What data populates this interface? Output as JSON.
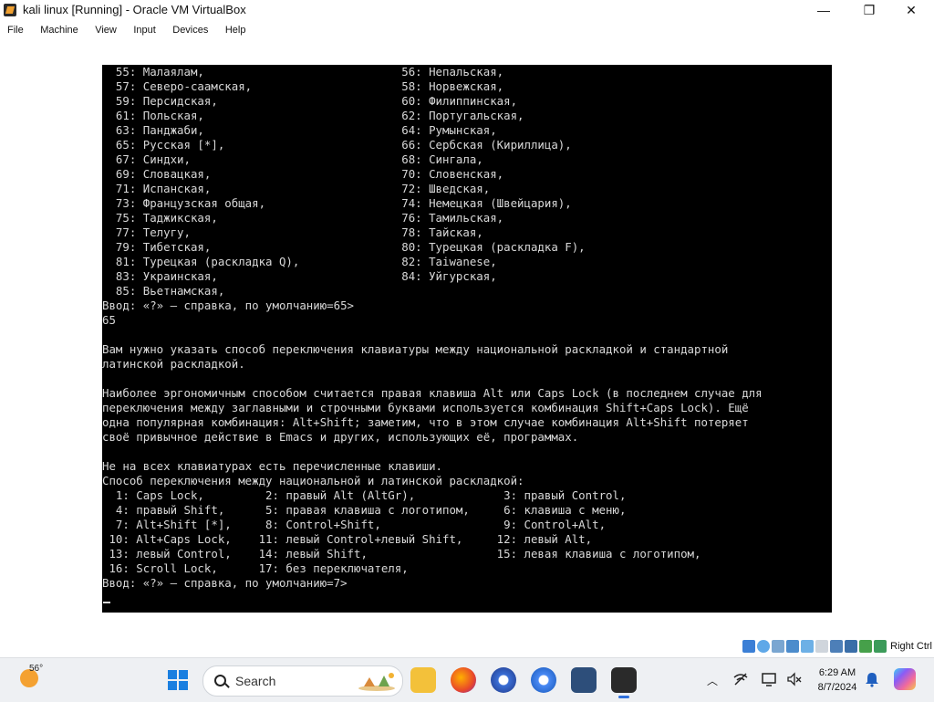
{
  "window": {
    "title": "kali linux [Running] - Oracle VM VirtualBox",
    "minimize": "—",
    "maximize": "❐",
    "close": "✕"
  },
  "menu": {
    "file": "File",
    "machine": "Machine",
    "view": "View",
    "input": "Input",
    "devices": "Devices",
    "help": "Help"
  },
  "console": {
    "lines": [
      "  55: Малаялам,                             56: Непальская,",
      "  57: Северо-саамская,                      58: Норвежская,",
      "  59: Персидская,                           60: Филиппинская,",
      "  61: Польская,                             62: Португальская,",
      "  63: Панджаби,                             64: Румынская,",
      "  65: Русская [*],                          66: Сербская (Кириллица),",
      "  67: Синдхи,                               68: Сингала,",
      "  69: Словацкая,                            70: Словенская,",
      "  71: Испанская,                            72: Шведская,",
      "  73: Французская общая,                    74: Немецкая (Швейцария),",
      "  75: Таджикская,                           76: Тамильская,",
      "  77: Телугу,                               78: Тайская,",
      "  79: Тибетская,                            80: Турецкая (раскладка F),",
      "  81: Турецкая (раскладка Q),               82: Taiwanese,",
      "  83: Украинская,                           84: Уйгурская,",
      "  85: Вьетнамская,",
      "Ввод: «?» — справка, по умолчанию=65>",
      "65",
      "",
      "Вам нужно указать способ переключения клавиатуры между национальной раскладкой и стандартной",
      "латинской раскладкой.",
      "",
      "Наиболее эргономичным способом считается правая клавиша Alt или Caps Lock (в последнем случае для",
      "переключения между заглавными и строчными буквами используется комбинация Shift+Caps Lock). Ещё",
      "одна популярная комбинация: Alt+Shift; заметим, что в этом случае комбинация Alt+Shift потеряет",
      "своё привычное действие в Emacs и других, использующих её, программах.",
      "",
      "Не на всех клавиатурах есть перечисленные клавиши.",
      "Способ переключения между национальной и латинской раскладкой:",
      "  1: Caps Lock,         2: правый Alt (AltGr),             3: правый Control,",
      "  4: правый Shift,      5: правая клавиша с логотипом,     6: клавиша с меню,",
      "  7: Alt+Shift [*],     8: Control+Shift,                  9: Control+Alt,",
      " 10: Alt+Caps Lock,    11: левый Control+левый Shift,     12: левый Alt,",
      " 13: левый Control,    14: левый Shift,                   15: левая клавиша с логотипом,",
      " 16: Scroll Lock,      17: без переключателя,",
      "Ввод: «?» — справка, по умолчанию=7>"
    ]
  },
  "statusbar": {
    "host_key": "Right Ctrl",
    "icon_names": [
      "hard-disk-icon",
      "optical-drive-icon",
      "audio-icon",
      "network-icon",
      "usb-icon",
      "shared-folders-icon",
      "display-icon",
      "video-capture-icon",
      "mouse-integration-icon",
      "host-key-icon"
    ]
  },
  "taskbar": {
    "weather_temp": "56°",
    "search_label": "Search",
    "time": "6:29 AM",
    "date": "8/7/2024",
    "apps": [
      "start-icon",
      "file-explorer-icon",
      "firefox-icon",
      "chrome-canary-icon",
      "chrome-icon",
      "virtualbox-icon",
      "kali-vm-icon"
    ]
  },
  "colors": {
    "console_bg": "#000000",
    "console_text": "#d8d8d8",
    "accent": "#1a7fe0"
  }
}
